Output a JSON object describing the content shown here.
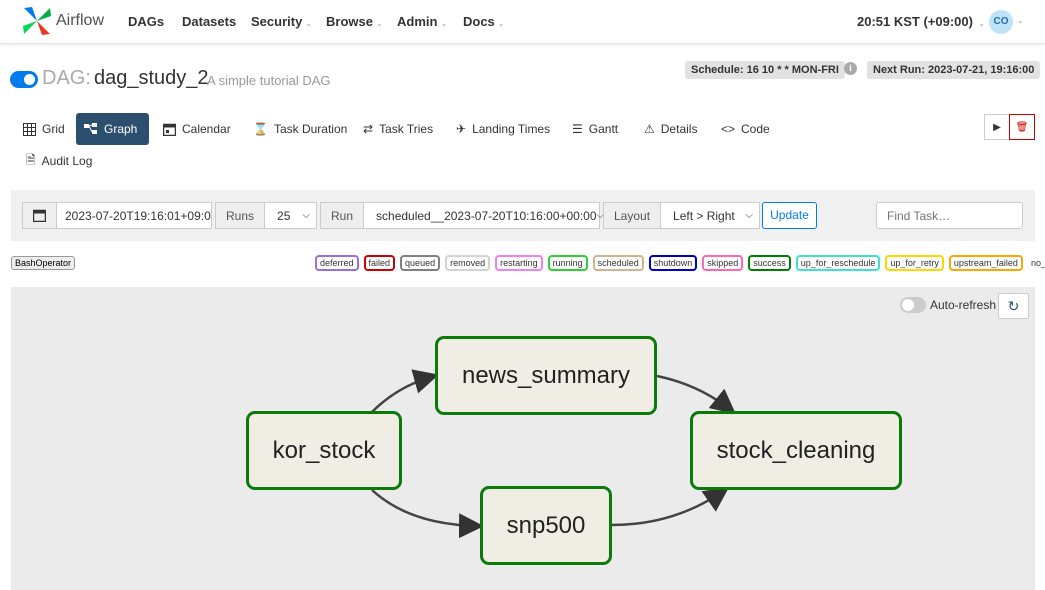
{
  "navbar": {
    "brand": "Airflow",
    "items": [
      "DAGs",
      "Datasets",
      "Security",
      "Browse",
      "Admin",
      "Docs"
    ],
    "time": "20:51 KST (+09:00)",
    "avatar": "CO"
  },
  "dag": {
    "prefix": "DAG:",
    "id": "dag_study_2",
    "description": "A simple tutorial DAG",
    "schedule": "Schedule: 16 10 * * MON-FRI",
    "next_run": "Next Run: 2023-07-21, 19:16:00",
    "paused": false
  },
  "tabs": [
    {
      "label": "Grid",
      "icon": "grid-icon"
    },
    {
      "label": "Graph",
      "icon": "graph-icon",
      "active": true
    },
    {
      "label": "Calendar",
      "icon": "calendar-icon"
    },
    {
      "label": "Task Duration",
      "icon": "hourglass-icon"
    },
    {
      "label": "Task Tries",
      "icon": "retry-icon"
    },
    {
      "label": "Landing Times",
      "icon": "landing-icon"
    },
    {
      "label": "Gantt",
      "icon": "gantt-icon"
    },
    {
      "label": "Details",
      "icon": "warning-icon"
    },
    {
      "label": "Code",
      "icon": "code-icon"
    },
    {
      "label": "Audit Log",
      "icon": "document-search-icon"
    }
  ],
  "filters": {
    "base_date": "2023-07-20T19:16:01+09:0",
    "runs_label": "Runs",
    "runs_value": "25",
    "run_label": "Run",
    "run_value": "scheduled__2023-07-20T10:16:00+00:00",
    "layout_label": "Layout",
    "layout_value": "Left > Right",
    "update_label": "Update",
    "find_placeholder": "Find Task…"
  },
  "operator_badge": "BashOperator",
  "legend": [
    {
      "label": "deferred",
      "color": "#9370db"
    },
    {
      "label": "failed",
      "color": "#cc0000"
    },
    {
      "label": "queued",
      "color": "#808080"
    },
    {
      "label": "removed",
      "color": "#d3d3d3"
    },
    {
      "label": "restarting",
      "color": "#ee82ee"
    },
    {
      "label": "running",
      "color": "#32cd32"
    },
    {
      "label": "scheduled",
      "color": "#d2b48c"
    },
    {
      "label": "shutdown",
      "color": "#0000cc"
    },
    {
      "label": "skipped",
      "color": "#ff69b4"
    },
    {
      "label": "success",
      "color": "#008000"
    },
    {
      "label": "up_for_reschedule",
      "color": "#40e0d0"
    },
    {
      "label": "up_for_retry",
      "color": "#ffd700"
    },
    {
      "label": "upstream_failed",
      "color": "#ffa500"
    }
  ],
  "legend_no_status": "no_status",
  "graph": {
    "auto_refresh_label": "Auto-refresh",
    "nodes": [
      "kor_stock",
      "news_summary",
      "snp500",
      "stock_cleaning"
    ],
    "node_status_color": "#0a7a0a"
  }
}
